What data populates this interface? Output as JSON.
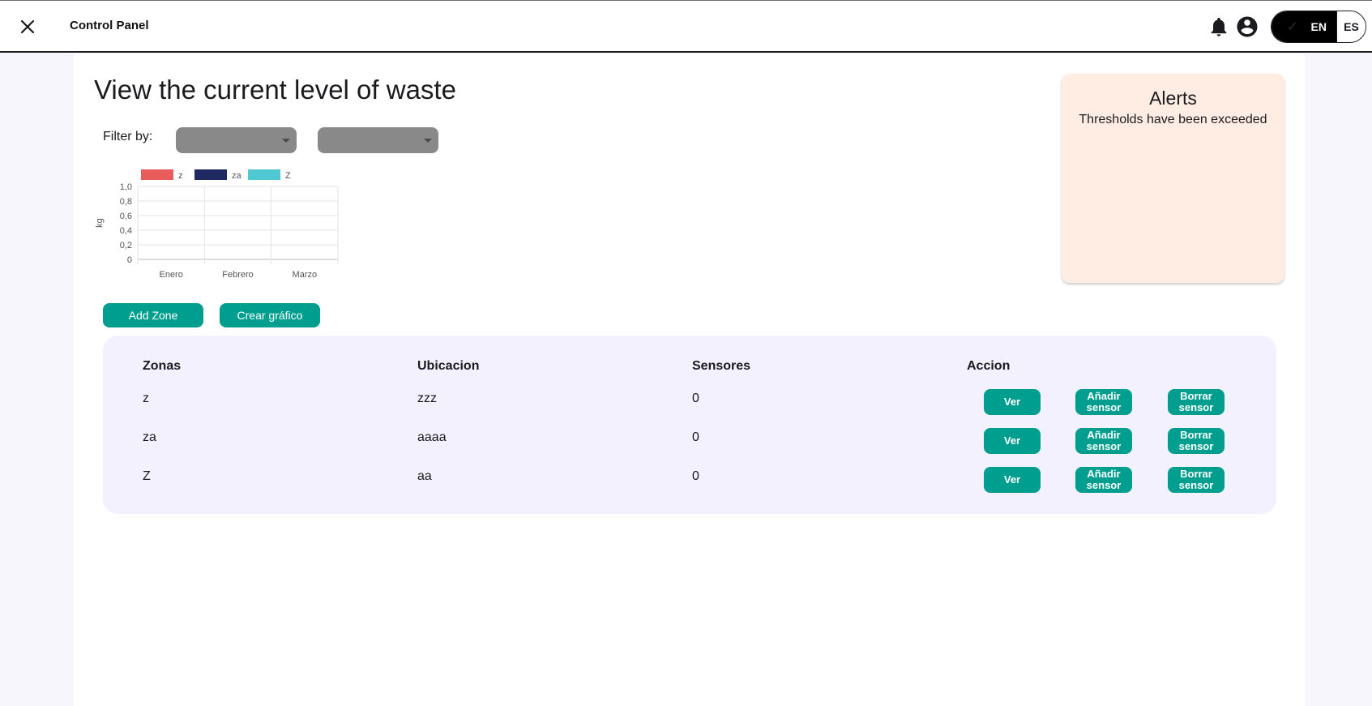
{
  "header": {
    "title": "Control Panel",
    "close_icon": "close-icon",
    "bell_icon": "bell-icon",
    "account_icon": "account-circle-icon",
    "language": {
      "options": [
        "EN",
        "ES"
      ],
      "selected": "EN"
    }
  },
  "main": {
    "title": "View the current level of waste",
    "filter": {
      "label": "Filter by:",
      "select_1": "",
      "select_2": ""
    },
    "buttons": {
      "add_zone": "Add Zone",
      "crear_grafico": "Crear gráfico"
    }
  },
  "alerts": {
    "title": "Alerts",
    "message": "Thresholds have been exceeded",
    "background": "#ffede4"
  },
  "chart_data": {
    "type": "bar",
    "categories": [
      "Enero",
      "Febrero",
      "Marzo"
    ],
    "series": [
      {
        "name": "z",
        "values": [
          0,
          0,
          0
        ],
        "color": "#e85c5c"
      },
      {
        "name": "za",
        "values": [
          0,
          0,
          0
        ],
        "color": "#1f2a63"
      },
      {
        "name": "Z",
        "values": [
          0,
          0,
          0
        ],
        "color": "#4fc8d2"
      }
    ],
    "yticks": [
      "0",
      "0,2",
      "0,4",
      "0,6",
      "0,8",
      "1,0"
    ],
    "ylim": [
      0,
      1
    ],
    "ylabel": "kg",
    "xlabel": "",
    "legend": "top-left",
    "grid": true
  },
  "table": {
    "headers": [
      "Zonas",
      "Ubicacion",
      "Sensores",
      "Accion"
    ],
    "rows": [
      {
        "zona": "z",
        "ubicacion": "zzz",
        "sensores": "0"
      },
      {
        "zona": "za",
        "ubicacion": "aaaa",
        "sensores": "0"
      },
      {
        "zona": "Z",
        "ubicacion": "aa",
        "sensores": "0"
      }
    ],
    "actions": {
      "ver": "Ver",
      "anadir_1": "Añadir",
      "anadir_2": "sensor",
      "borrar_1": "Borrar",
      "borrar_2": "sensor"
    }
  },
  "colors": {
    "accent": "#009e8e",
    "table_bg": "#f2f1fd",
    "page_bg": "#f6f6fc"
  }
}
